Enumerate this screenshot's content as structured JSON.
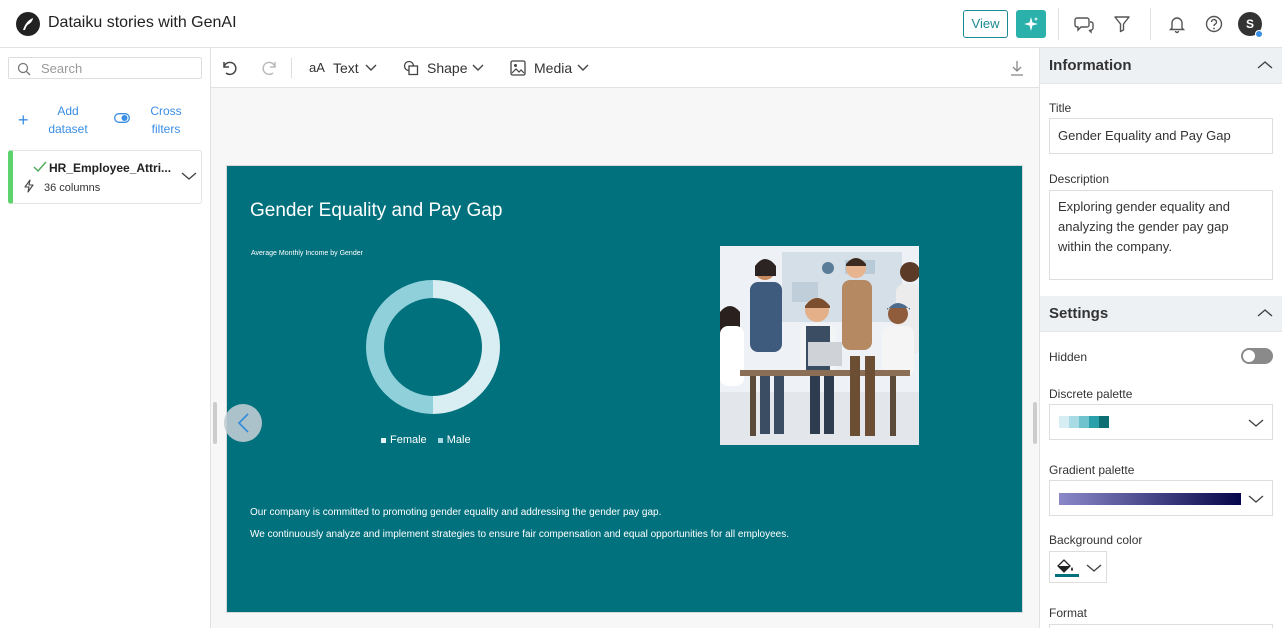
{
  "header": {
    "title": "Dataiku stories with GenAI",
    "view_label": "View",
    "avatar_initial": "S"
  },
  "left": {
    "search_placeholder": "Search",
    "add_dataset_label": "Add dataset",
    "cross_filters_label": "Cross filters",
    "dataset": {
      "name": "HR_Employee_Attri...",
      "columns": "36 columns",
      "status_color": "#5cd36d"
    }
  },
  "toolbar": {
    "text_label": "Text",
    "text_icon": "aA",
    "shape_label": "Shape",
    "media_label": "Media"
  },
  "slide": {
    "title": "Gender Equality and Pay Gap",
    "chart_title": "Average Monthly Income by Gender",
    "legend": [
      {
        "label": "Female",
        "color": "#b3dfe6"
      },
      {
        "label": "Male",
        "color": "#8fd0da"
      }
    ],
    "text_line1": "Our company is committed to promoting gender equality and addressing the gender pay gap.",
    "text_line2": "We continuously analyze and implement strategies to ensure fair compensation and equal opportunities for all employees.",
    "background": "#01717e"
  },
  "chart_data": {
    "type": "pie",
    "title": "Average Monthly Income by Gender",
    "categories": [
      "Female",
      "Male"
    ],
    "values": [
      50,
      50
    ],
    "colors": [
      "#d8eef2",
      "#8fd0da"
    ],
    "legend_position": "bottom"
  },
  "right": {
    "information_label": "Information",
    "title_label": "Title",
    "title_value": "Gender Equality and Pay Gap",
    "description_label": "Description",
    "description_value": "Exploring gender equality and analyzing the gender pay gap within the company.",
    "settings_label": "Settings",
    "hidden_label": "Hidden",
    "discrete_palette_label": "Discrete palette",
    "discrete_palette_colors": [
      "#d6eef3",
      "#a8dbe4",
      "#6ec3cf",
      "#2aa0ab",
      "#0d6f74"
    ],
    "gradient_palette_label": "Gradient palette",
    "gradient_colors": [
      "#8a88c8",
      "#06064a"
    ],
    "background_color_label": "Background color",
    "background_color_value": "#01717e",
    "format_label": "Format"
  }
}
